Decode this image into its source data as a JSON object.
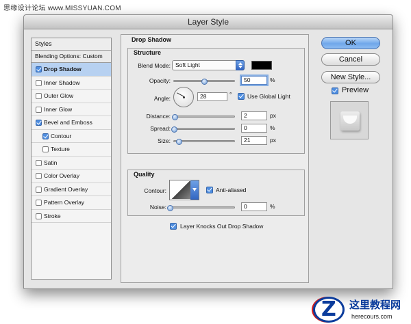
{
  "watermark_top": "思缘设计论坛 www.MISSYUAN.COM",
  "window": {
    "title": "Layer Style"
  },
  "styles_panel": {
    "header": "Styles",
    "blending_options": "Blending Options: Custom",
    "items": [
      {
        "label": "Drop Shadow",
        "checked": true,
        "selected": true
      },
      {
        "label": "Inner Shadow",
        "checked": false
      },
      {
        "label": "Outer Glow",
        "checked": false
      },
      {
        "label": "Inner Glow",
        "checked": false
      },
      {
        "label": "Bevel and Emboss",
        "checked": true
      },
      {
        "label": "Contour",
        "checked": true,
        "indent": true
      },
      {
        "label": "Texture",
        "checked": false,
        "indent": true
      },
      {
        "label": "Satin",
        "checked": false
      },
      {
        "label": "Color Overlay",
        "checked": false
      },
      {
        "label": "Gradient Overlay",
        "checked": false
      },
      {
        "label": "Pattern Overlay",
        "checked": false
      },
      {
        "label": "Stroke",
        "checked": false
      }
    ]
  },
  "drop_shadow": {
    "title": "Drop Shadow",
    "structure": {
      "title": "Structure",
      "blend_mode_label": "Blend Mode:",
      "blend_mode_value": "Soft Light",
      "shadow_color": "#000000",
      "opacity_label": "Opacity:",
      "opacity_value": "50",
      "opacity_unit": "%",
      "opacity_fraction": 0.5,
      "angle_label": "Angle:",
      "angle_value": "28",
      "angle_unit": "°",
      "use_global_light_label": "Use Global Light",
      "distance_label": "Distance:",
      "distance_value": "2",
      "distance_unit": "px",
      "spread_label": "Spread:",
      "spread_value": "0",
      "spread_unit": "%",
      "size_label": "Size:",
      "size_value": "21",
      "size_unit": "px"
    },
    "quality": {
      "title": "Quality",
      "contour_label": "Contour:",
      "anti_aliased_label": "Anti-aliased",
      "noise_label": "Noise:",
      "noise_value": "0",
      "noise_unit": "%"
    },
    "knockout_label": "Layer Knocks Out Drop Shadow"
  },
  "buttons": {
    "ok": "OK",
    "cancel": "Cancel",
    "new_style": "New Style...",
    "preview_label": "Preview"
  },
  "logo": {
    "title": "这里教程网",
    "url": "herecours.com"
  },
  "colors": {
    "accent": "#4f8ee0",
    "selection": "#b7d1f1"
  }
}
